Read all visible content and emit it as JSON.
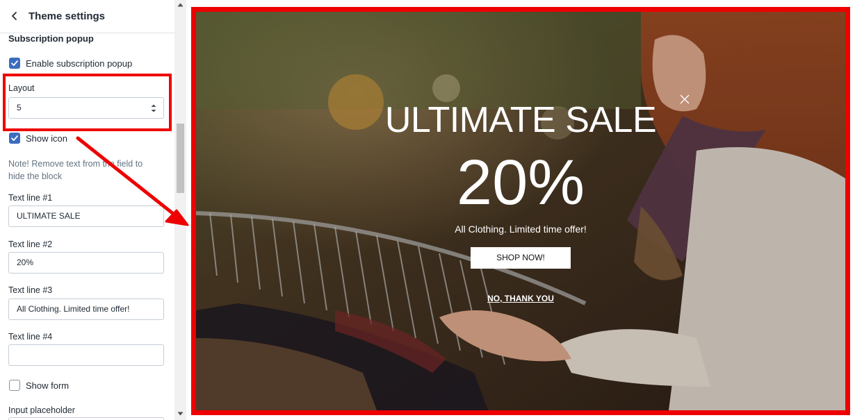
{
  "header": {
    "title": "Theme settings"
  },
  "section": {
    "title": "Subscription popup"
  },
  "settings": {
    "enable_popup": {
      "label": "Enable subscription popup",
      "checked": true
    },
    "layout": {
      "label": "Layout",
      "value": "5"
    },
    "show_icon": {
      "label": "Show icon",
      "checked": true
    },
    "note": "Note! Remove text from the field to hide the block",
    "text_line_1": {
      "label": "Text line #1",
      "value": "ULTIMATE SALE"
    },
    "text_line_2": {
      "label": "Text line #2",
      "value": "20%"
    },
    "text_line_3": {
      "label": "Text line #3",
      "value": "All Clothing. Limited time offer!"
    },
    "text_line_4": {
      "label": "Text line #4",
      "value": ""
    },
    "show_form": {
      "label": "Show form",
      "checked": false
    },
    "input_placeholder": {
      "label": "Input placeholder"
    }
  },
  "popup": {
    "title": "ULTIMATE SALE",
    "percent": "20%",
    "subtitle": "All Clothing. Limited time offer!",
    "button": "SHOP NOW!",
    "dismiss": "NO, THANK YOU"
  },
  "colors": {
    "highlight": "#ee0000",
    "checkbox": "#3b6cbf",
    "photo_background": "#4a3020"
  },
  "icons": [
    "back-arrow-icon",
    "checkmark-icon",
    "select-arrows-icon",
    "close-icon",
    "scroll-up-icon",
    "scroll-down-icon"
  ]
}
